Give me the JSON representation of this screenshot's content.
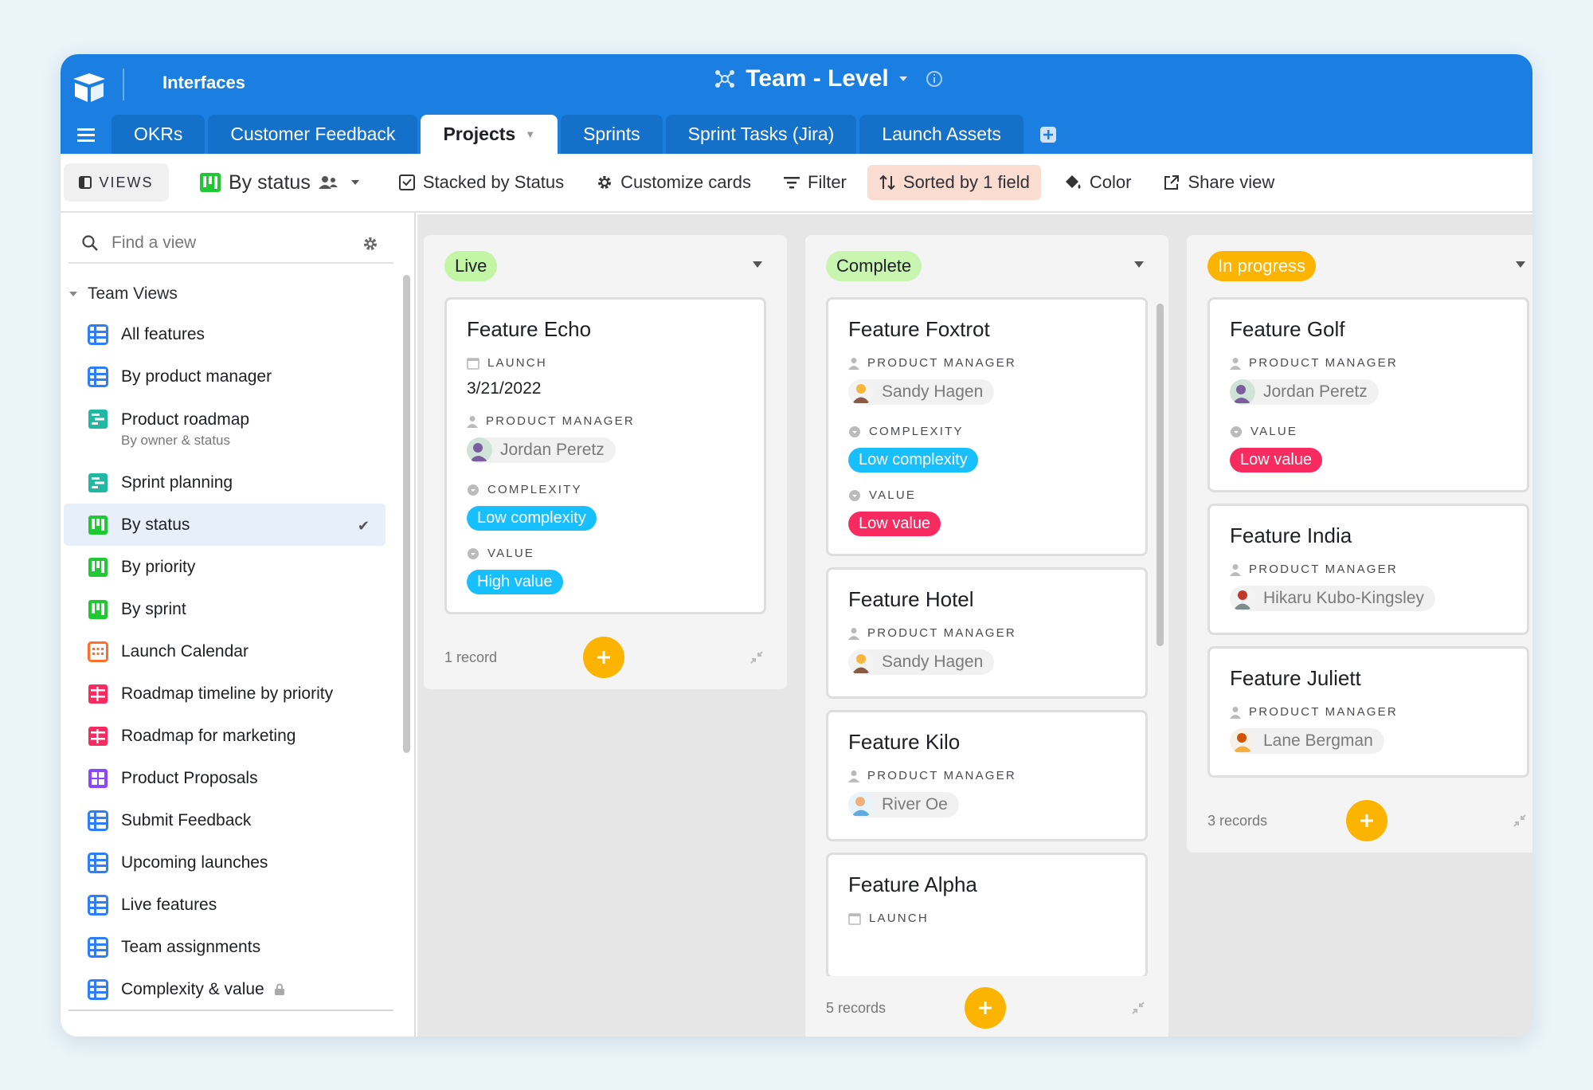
{
  "colors": {
    "header_blue": "#1a7fe0",
    "tab_blue": "#1470c9",
    "accent_yellow": "#fcb400",
    "live_green": "#c2f5a4",
    "complete_green": "#c8f5b0",
    "in_progress_orange": "#fcb400",
    "cyan_tag": "#18bfff",
    "red_tag": "#f82b60"
  },
  "header": {
    "app_link": "Interfaces",
    "base_title": "Team - Level"
  },
  "tabs": [
    {
      "label": "OKRs"
    },
    {
      "label": "Customer Feedback"
    },
    {
      "label": "Projects",
      "active": true
    },
    {
      "label": "Sprints"
    },
    {
      "label": "Sprint Tasks (Jira)"
    },
    {
      "label": "Launch Assets"
    }
  ],
  "toolbar": {
    "views_label": "VIEWS",
    "current_view": "By status",
    "stacked": "Stacked by Status",
    "customize": "Customize cards",
    "filter": "Filter",
    "sorted": "Sorted by 1 field",
    "color": "Color",
    "share": "Share view"
  },
  "sidebar": {
    "search_placeholder": "Find a view",
    "section_title": "Team Views",
    "items": [
      {
        "label": "All features",
        "icon": "grid-view-icon"
      },
      {
        "label": "By product manager",
        "icon": "grid-view-icon"
      },
      {
        "label": "Product roadmap",
        "sub": "By owner & status",
        "icon": "gantt-view-icon"
      },
      {
        "label": "Sprint planning",
        "icon": "gantt-view-icon"
      },
      {
        "label": "By status",
        "icon": "kanban-view-icon",
        "active": true
      },
      {
        "label": "By priority",
        "icon": "kanban-view-icon"
      },
      {
        "label": "By sprint",
        "icon": "kanban-view-icon"
      },
      {
        "label": "Launch Calendar",
        "icon": "calendar-view-icon"
      },
      {
        "label": "Roadmap timeline by priority",
        "icon": "timeline-view-icon"
      },
      {
        "label": "Roadmap for marketing",
        "icon": "timeline-view-icon"
      },
      {
        "label": "Product Proposals",
        "icon": "gallery-view-icon"
      },
      {
        "label": "Submit Feedback",
        "icon": "grid-view-icon"
      },
      {
        "label": "Upcoming launches",
        "icon": "grid-view-icon"
      },
      {
        "label": "Live features",
        "icon": "grid-view-icon"
      },
      {
        "label": "Team assignments",
        "icon": "grid-view-icon"
      },
      {
        "label": "Complexity & value",
        "icon": "grid-view-icon",
        "locked": true
      }
    ]
  },
  "columns": [
    {
      "status": "Live",
      "record_count": "1 record",
      "cards": [
        {
          "title": "Feature Echo",
          "fields": [
            {
              "label": "LAUNCH",
              "kind": "date",
              "value": "3/21/2022"
            },
            {
              "label": "PRODUCT MANAGER",
              "kind": "person",
              "value": "Jordan Peretz"
            },
            {
              "label": "COMPLEXITY",
              "kind": "tag",
              "value": "Low complexity",
              "color": "#18bfff"
            },
            {
              "label": "VALUE",
              "kind": "tag",
              "value": "High value",
              "color": "#18bfff"
            }
          ]
        }
      ]
    },
    {
      "status": "Complete",
      "record_count": "5 records",
      "cards": [
        {
          "title": "Feature Foxtrot",
          "fields": [
            {
              "label": "PRODUCT MANAGER",
              "kind": "person",
              "value": "Sandy Hagen"
            },
            {
              "label": "COMPLEXITY",
              "kind": "tag",
              "value": "Low complexity",
              "color": "#18bfff"
            },
            {
              "label": "VALUE",
              "kind": "tag",
              "value": "Low value",
              "color": "#f82b60"
            }
          ]
        },
        {
          "title": "Feature Hotel",
          "fields": [
            {
              "label": "PRODUCT MANAGER",
              "kind": "person",
              "value": "Sandy Hagen"
            }
          ]
        },
        {
          "title": "Feature Kilo",
          "fields": [
            {
              "label": "PRODUCT MANAGER",
              "kind": "person",
              "value": "River Oe"
            }
          ]
        },
        {
          "title": "Feature Alpha",
          "fields": [
            {
              "label": "LAUNCH",
              "kind": "date",
              "value": ""
            }
          ]
        }
      ]
    },
    {
      "status": "In progress",
      "record_count": "3 records",
      "cards": [
        {
          "title": "Feature Golf",
          "fields": [
            {
              "label": "PRODUCT MANAGER",
              "kind": "person",
              "value": "Jordan Peretz"
            },
            {
              "label": "VALUE",
              "kind": "tag",
              "value": "Low value",
              "color": "#f82b60"
            }
          ]
        },
        {
          "title": "Feature India",
          "fields": [
            {
              "label": "PRODUCT MANAGER",
              "kind": "person",
              "value": "Hikaru Kubo-Kingsley"
            }
          ]
        },
        {
          "title": "Feature Juliett",
          "fields": [
            {
              "label": "PRODUCT MANAGER",
              "kind": "person",
              "value": "Lane Bergman"
            }
          ]
        }
      ]
    }
  ]
}
